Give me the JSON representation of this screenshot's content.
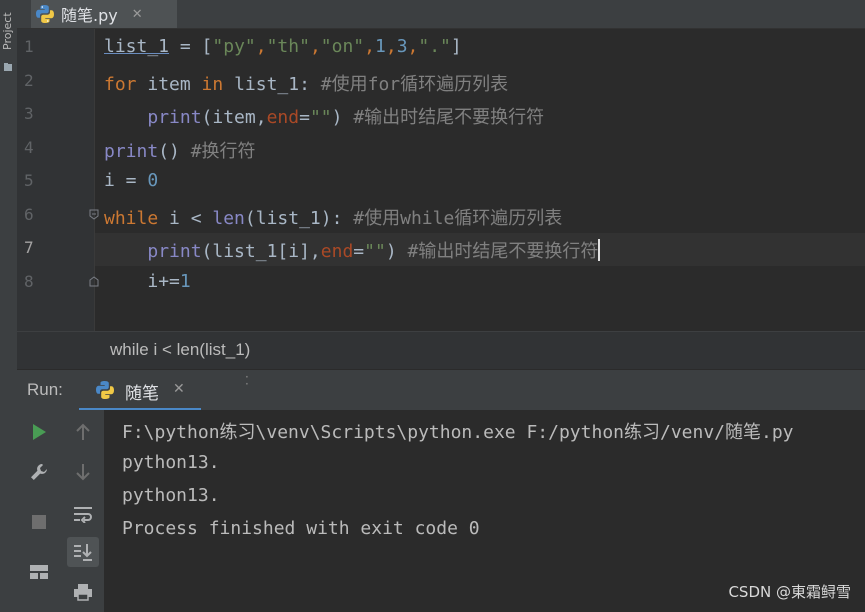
{
  "project_strip": {
    "label": "Project"
  },
  "editor_tab": {
    "file_name": "随笔.py",
    "close": "✕"
  },
  "gutter": {
    "line_numbers": [
      "1",
      "2",
      "3",
      "4",
      "5",
      "6",
      "7",
      "8"
    ],
    "current_line": "7"
  },
  "code": {
    "line1": {
      "var": "list_1",
      "eq": " = [",
      "s1": "\"py\"",
      "c1": ",",
      "s2": "\"th\"",
      "c2": ",",
      "s3": "\"on\"",
      "c3": ",",
      "n1": "1",
      "c4": ",",
      "n2": "3",
      "c5": ",",
      "s4": "\".\"",
      "close": "]"
    },
    "line2": {
      "kw1": "for",
      "mid1": " item ",
      "kw2": "in",
      "mid2": " list_1: ",
      "comment": "#使用for循环遍历列表"
    },
    "line3": {
      "indent": "    ",
      "fn": "print",
      "open": "(item,",
      "param": "end",
      "eq": "=",
      "str": "\"\"",
      "close": ") ",
      "comment": "#输出时结尾不要换行符"
    },
    "line4": {
      "fn": "print",
      "rest": "() ",
      "comment": "#换行符"
    },
    "line5": {
      "lhs": "i = ",
      "num": "0"
    },
    "line6": {
      "kw": "while",
      "mid": " i < ",
      "builtin": "len",
      "rest": "(list_1): ",
      "comment": "#使用while循环遍历列表"
    },
    "line7": {
      "indent": "    ",
      "fn": "print",
      "open": "(list_1[i],",
      "param": "end",
      "eq": "=",
      "str": "\"\"",
      "close": ") ",
      "comment": "#输出时结尾不要换行符"
    },
    "line8": {
      "indent": "    ",
      "lhs": "i+=",
      "num": "1"
    }
  },
  "breadcrumb": {
    "text": "while i < len(list_1)"
  },
  "run_panel": {
    "label": "Run:",
    "tab_name": "随笔",
    "tab_close": "✕",
    "console_lines": [
      "F:\\python练习\\venv\\Scripts\\python.exe F:/python练习/venv/随笔.py",
      "python13.",
      "python13.",
      "Process finished with exit code 0"
    ]
  },
  "watermark": {
    "text": "CSDN @東霜鲟雪"
  },
  "colors": {
    "keyword": "#cc7832",
    "string": "#6a8759",
    "number": "#6897bb",
    "comment": "#808080",
    "run_green": "#499c54"
  }
}
